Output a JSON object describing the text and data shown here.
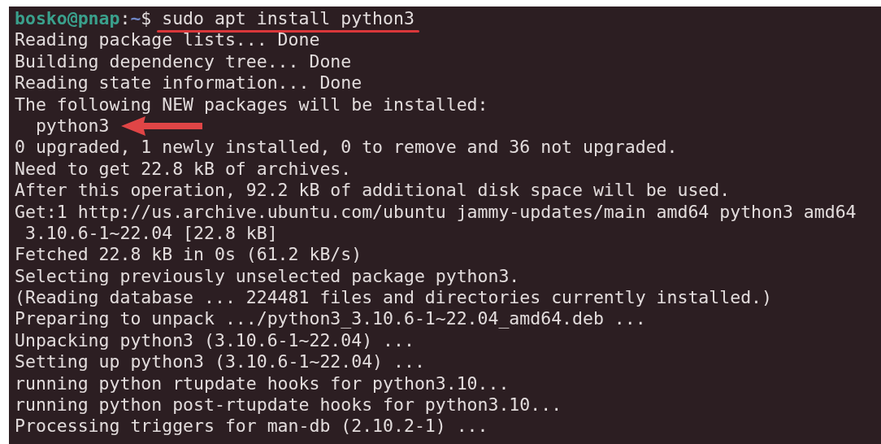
{
  "terminal": {
    "lines": [
      {
        "kind": "prompt",
        "user_host": "bosko@pnap",
        "colon": ":",
        "path": "~",
        "symbol": "$",
        "command": "sudo apt install python3",
        "underlined": true
      },
      {
        "kind": "output",
        "text": "Reading package lists... Done",
        "arrow": false
      },
      {
        "kind": "output",
        "text": "Building dependency tree... Done",
        "arrow": false
      },
      {
        "kind": "output",
        "text": "Reading state information... Done",
        "arrow": false
      },
      {
        "kind": "output",
        "text": "The following NEW packages will be installed:",
        "arrow": false
      },
      {
        "kind": "output",
        "text": "  python3",
        "arrow": true
      },
      {
        "kind": "output",
        "text": "0 upgraded, 1 newly installed, 0 to remove and 36 not upgraded.",
        "arrow": false
      },
      {
        "kind": "output",
        "text": "Need to get 22.8 kB of archives.",
        "arrow": false
      },
      {
        "kind": "output",
        "text": "After this operation, 92.2 kB of additional disk space will be used.",
        "arrow": false
      },
      {
        "kind": "output",
        "text": "Get:1 http://us.archive.ubuntu.com/ubuntu jammy-updates/main amd64 python3 amd64",
        "arrow": false
      },
      {
        "kind": "output",
        "text": " 3.10.6-1~22.04 [22.8 kB]",
        "arrow": false
      },
      {
        "kind": "output",
        "text": "Fetched 22.8 kB in 0s (61.2 kB/s)",
        "arrow": false
      },
      {
        "kind": "output",
        "text": "Selecting previously unselected package python3.",
        "arrow": false
      },
      {
        "kind": "output",
        "text": "(Reading database ... 224481 files and directories currently installed.)",
        "arrow": false
      },
      {
        "kind": "output",
        "text": "Preparing to unpack .../python3_3.10.6-1~22.04_amd64.deb ...",
        "arrow": false
      },
      {
        "kind": "output",
        "text": "Unpacking python3 (3.10.6-1~22.04) ...",
        "arrow": false
      },
      {
        "kind": "output",
        "text": "Setting up python3 (3.10.6-1~22.04) ...",
        "arrow": false
      },
      {
        "kind": "output",
        "text": "running python rtupdate hooks for python3.10...",
        "arrow": false
      },
      {
        "kind": "output",
        "text": "running python post-rtupdate hooks for python3.10...",
        "arrow": false
      },
      {
        "kind": "output",
        "text": "Processing triggers for man-db (2.10.2-1) ...",
        "arrow": false
      }
    ]
  }
}
